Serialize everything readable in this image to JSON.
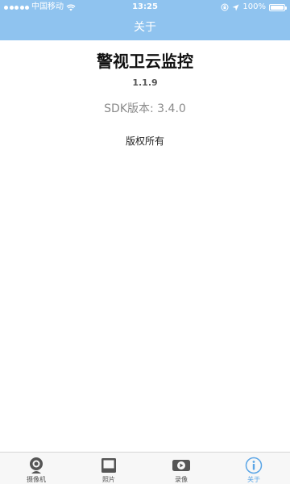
{
  "status_bar": {
    "carrier": "中国移动",
    "time": "13:25",
    "battery": "100%",
    "battery_level": 1.0
  },
  "nav": {
    "title": "关于"
  },
  "about": {
    "app_name": "警视卫云监控",
    "version": "1.1.9",
    "sdk_version": "SDK版本: 3.4.0",
    "copyright": "版权所有"
  },
  "tabs": [
    {
      "label": "摄像机",
      "icon": "camera-icon",
      "active": false
    },
    {
      "label": "照片",
      "icon": "photo-icon",
      "active": false
    },
    {
      "label": "录像",
      "icon": "video-icon",
      "active": false
    },
    {
      "label": "关于",
      "icon": "info-icon",
      "active": true
    }
  ],
  "colors": {
    "header_bg": "#8fc3ef",
    "accent": "#5aa5e6",
    "tab_icon_inactive": "#555555"
  }
}
